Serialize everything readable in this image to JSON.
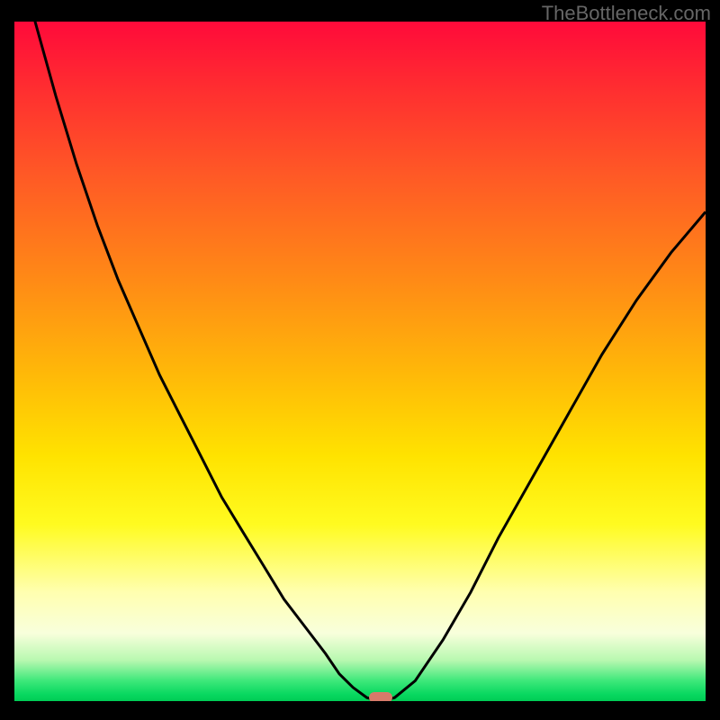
{
  "watermark": "TheBottleneck.com",
  "chart_data": {
    "type": "line",
    "title": "",
    "xlabel": "",
    "ylabel": "",
    "xlim": [
      0,
      100
    ],
    "ylim": [
      0,
      100
    ],
    "x": [
      0,
      3,
      6,
      9,
      12,
      15,
      18,
      21,
      24,
      27,
      30,
      33,
      36,
      39,
      42,
      45,
      47,
      49,
      51,
      53,
      55,
      58,
      62,
      66,
      70,
      75,
      80,
      85,
      90,
      95,
      100
    ],
    "values": [
      113,
      100,
      89,
      79,
      70,
      62,
      55,
      48,
      42,
      36,
      30,
      25,
      20,
      15,
      11,
      7,
      4,
      2,
      0.5,
      0,
      0.5,
      3,
      9,
      16,
      24,
      33,
      42,
      51,
      59,
      66,
      72
    ],
    "marker": {
      "x": 53,
      "y": 0.5
    },
    "gradient": {
      "top": "#ff0a3a",
      "mid": "#ffe300",
      "bottom": "#00cc55"
    }
  }
}
